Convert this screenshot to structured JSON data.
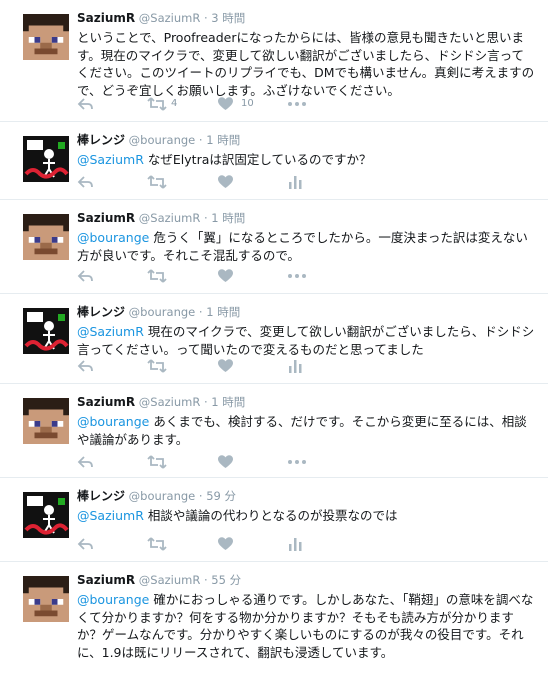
{
  "colors": {
    "link": "#1b95e0",
    "meta": "#8899a6",
    "icon": "#aab8c2",
    "border": "#e6ecf0"
  },
  "icons": [
    "reply-icon",
    "retweet-icon",
    "like-icon",
    "more-icon",
    "analytics-icon"
  ],
  "tweets": [
    {
      "author": "SaziumR",
      "handle": "@SaziumR",
      "time": "· 3 時間",
      "mention": "",
      "text": "ということで、Proofreaderになったからには、皆様の意見も聞きたいと思います。現在のマイクラで、変更して欲しい翻訳がございましたら、ドシドシ言ってください。このツイートのリプライでも、DMでも構いません。真剣に考えますので、どうぞ宜しくお願いします。ふざけないでください。",
      "retweets": "4",
      "likes": "10"
    },
    {
      "author": "棒レンジ",
      "handle": "@bourange",
      "time": "· 1 時間",
      "mention": "@SaziumR",
      "text": " なぜElytraは訳固定しているのですか？"
    },
    {
      "author": "SaziumR",
      "handle": "@SaziumR",
      "time": "· 1 時間",
      "mention": "@bourange",
      "text": " 危うく「翼」になるところでしたから。一度決まった訳は変えない方が良いです。それこそ混乱するので。"
    },
    {
      "author": "棒レンジ",
      "handle": "@bourange",
      "time": "· 1 時間",
      "mention": "@SaziumR",
      "text": " 現在のマイクラで、変更して欲しい翻訳がございましたら、ドシドシ言ってください。って聞いたので変えるものだと思ってました"
    },
    {
      "author": "SaziumR",
      "handle": "@SaziumR",
      "time": "· 1 時間",
      "mention": "@bourange",
      "text": " あくまでも、検討する、だけです。そこから変更に至るには、相談や議論があります。"
    },
    {
      "author": "棒レンジ",
      "handle": "@bourange",
      "time": "· 59 分",
      "mention": "@SaziumR",
      "text": " 相談や議論の代わりとなるのが投票なのでは"
    },
    {
      "author": "SaziumR",
      "handle": "@SaziumR",
      "time": "· 55 分",
      "mention": "@bourange",
      "text": " 確かにおっしゃる通りです。しかしあなた、「鞘翅」の意味を調べなくて分かりますか？何をする物か分かりますか？そもそも読み方が分かりますか？ゲームなんです。分かりやすく楽しいものにするのが我々の役目です。それに、1.9は既にリリースされて、翻訳も浸透しています。"
    }
  ]
}
